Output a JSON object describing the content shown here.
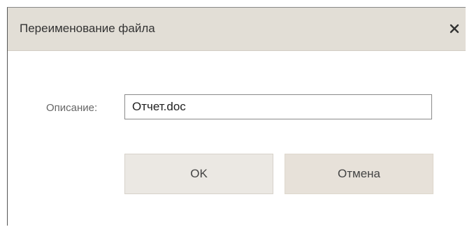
{
  "dialog": {
    "title": "Переименование файла",
    "close_icon": "close-icon",
    "field": {
      "label": "Описание:",
      "value": "Отчет.doc"
    },
    "buttons": {
      "ok_label": "OK",
      "cancel_label": "Отмена"
    }
  },
  "colors": {
    "titlebar_bg": "#e2ded6",
    "button_bg": "#ebe8e3",
    "cancel_bg": "#e7e1d9"
  }
}
